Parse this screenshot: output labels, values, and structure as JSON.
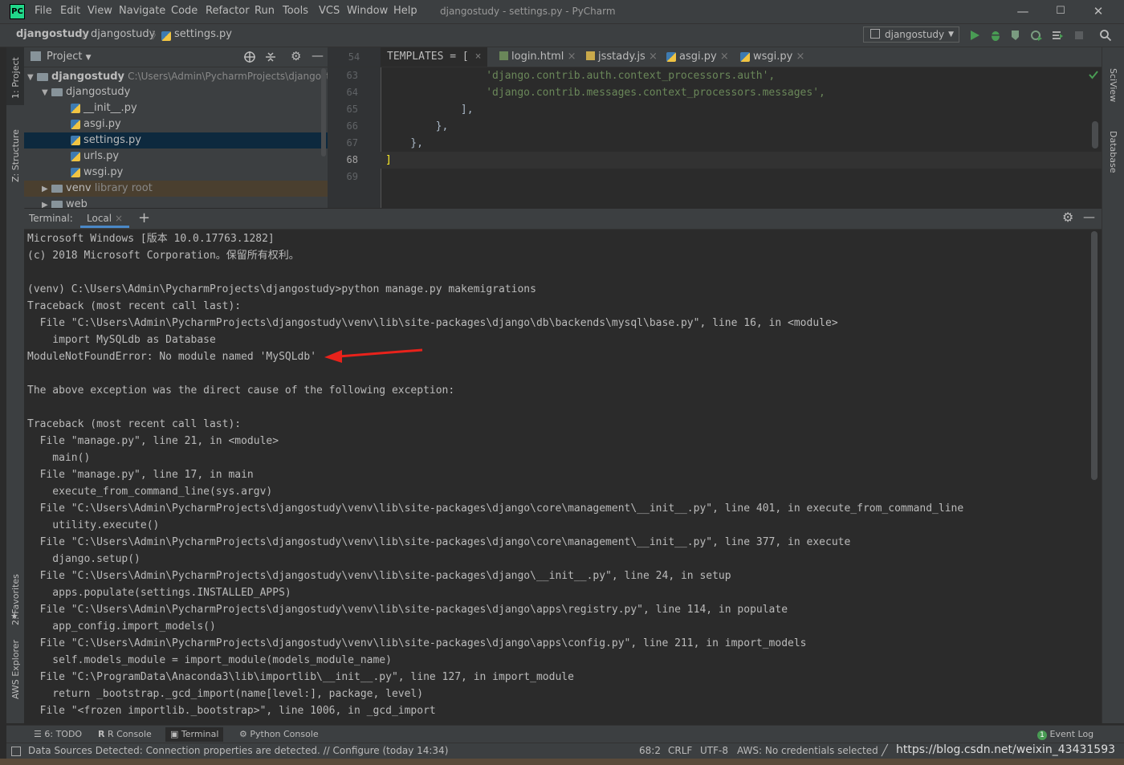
{
  "app": {
    "logo_text": "PC",
    "window_title": "djangostudy - settings.py - PyCharm",
    "menu": [
      "File",
      "Edit",
      "View",
      "Navigate",
      "Code",
      "Refactor",
      "Run",
      "Tools",
      "VCS",
      "Window",
      "Help"
    ]
  },
  "window_controls": {
    "minimize": "—",
    "maximize": "☐",
    "close": "✕"
  },
  "breadcrumb": [
    "djangostudy",
    "djangostudy",
    "settings.py"
  ],
  "run_config": {
    "label": "djangostudy"
  },
  "left_strip": {
    "project": "1: Project",
    "structure": "Z: Structure",
    "favorites": "2: Favorites",
    "aws": "AWS Explorer"
  },
  "right_strip": {
    "sciview": "SciView",
    "database": "Database"
  },
  "project_panel": {
    "title": "Project",
    "root": {
      "name": "djangostudy",
      "path": "C:\\Users\\Admin\\PycharmProjects\\djangostu"
    },
    "items": [
      {
        "name": "djangostudy"
      },
      {
        "name": "__init__.py"
      },
      {
        "name": "asgi.py"
      },
      {
        "name": "settings.py"
      },
      {
        "name": "urls.py"
      },
      {
        "name": "wsgi.py"
      },
      {
        "name": "venv",
        "note": "library root"
      },
      {
        "name": "web"
      }
    ]
  },
  "editor": {
    "tabs": [
      {
        "label": "TEMPLATES = ["
      },
      {
        "label": "login.html"
      },
      {
        "label": "jsstady.js"
      },
      {
        "label": "asgi.py"
      },
      {
        "label": "wsgi.py"
      }
    ],
    "tab_close": "×",
    "sticky_line": "54",
    "lines": [
      {
        "num": "63",
        "code": "                'django.contrib.auth.context_processors.auth',",
        "kind": "str"
      },
      {
        "num": "64",
        "code": "                'django.contrib.messages.context_processors.messages',",
        "kind": "str"
      },
      {
        "num": "65",
        "code": "            ],",
        "kind": "plain"
      },
      {
        "num": "66",
        "code": "        },",
        "kind": "plain"
      },
      {
        "num": "67",
        "code": "    },",
        "kind": "plain"
      },
      {
        "num": "68",
        "code": "]",
        "kind": "plain"
      },
      {
        "num": "69",
        "code": "",
        "kind": "plain"
      }
    ]
  },
  "terminal": {
    "label": "Terminal:",
    "tab": "Local",
    "tab_close": "×",
    "add": "+",
    "lines": [
      "Microsoft Windows [版本 10.0.17763.1282]",
      "(c) 2018 Microsoft Corporation。保留所有权利。",
      "",
      "(venv) C:\\Users\\Admin\\PycharmProjects\\djangostudy>python manage.py makemigrations",
      "Traceback (most recent call last):",
      "  File \"C:\\Users\\Admin\\PycharmProjects\\djangostudy\\venv\\lib\\site-packages\\django\\db\\backends\\mysql\\base.py\", line 16, in <module>",
      "    import MySQLdb as Database",
      "ModuleNotFoundError: No module named 'MySQLdb'",
      "",
      "The above exception was the direct cause of the following exception:",
      "",
      "Traceback (most recent call last):",
      "  File \"manage.py\", line 21, in <module>",
      "    main()",
      "  File \"manage.py\", line 17, in main",
      "    execute_from_command_line(sys.argv)",
      "  File \"C:\\Users\\Admin\\PycharmProjects\\djangostudy\\venv\\lib\\site-packages\\django\\core\\management\\__init__.py\", line 401, in execute_from_command_line",
      "    utility.execute()",
      "  File \"C:\\Users\\Admin\\PycharmProjects\\djangostudy\\venv\\lib\\site-packages\\django\\core\\management\\__init__.py\", line 377, in execute",
      "    django.setup()",
      "  File \"C:\\Users\\Admin\\PycharmProjects\\djangostudy\\venv\\lib\\site-packages\\django\\__init__.py\", line 24, in setup",
      "    apps.populate(settings.INSTALLED_APPS)",
      "  File \"C:\\Users\\Admin\\PycharmProjects\\djangostudy\\venv\\lib\\site-packages\\django\\apps\\registry.py\", line 114, in populate",
      "    app_config.import_models()",
      "  File \"C:\\Users\\Admin\\PycharmProjects\\djangostudy\\venv\\lib\\site-packages\\django\\apps\\config.py\", line 211, in import_models",
      "    self.models_module = import_module(models_module_name)",
      "  File \"C:\\ProgramData\\Anaconda3\\lib\\importlib\\__init__.py\", line 127, in import_module",
      "    return _bootstrap._gcd_import(name[level:], package, level)",
      "  File \"<frozen importlib._bootstrap>\", line 1006, in _gcd_import"
    ]
  },
  "bottom_tabs": {
    "todo": "6: TODO",
    "rconsole": "R Console",
    "terminal": "Terminal",
    "pyconsole": "Python Console",
    "eventlog": "Event Log"
  },
  "status": {
    "message": "Data Sources Detected: Connection properties are detected. // Configure (today 14:34)",
    "position": "68:2",
    "line_sep": "CRLF",
    "encoding": "UTF-8",
    "aws": "AWS: No credentials selected",
    "watermark": "https://blog.csdn.net/weixin_43431593"
  },
  "colors": {
    "bg": "#2b2b2b",
    "panel": "#3c3f41",
    "accent": "#21d789",
    "arrow": "#e8221b",
    "selection": "#0d293e"
  }
}
